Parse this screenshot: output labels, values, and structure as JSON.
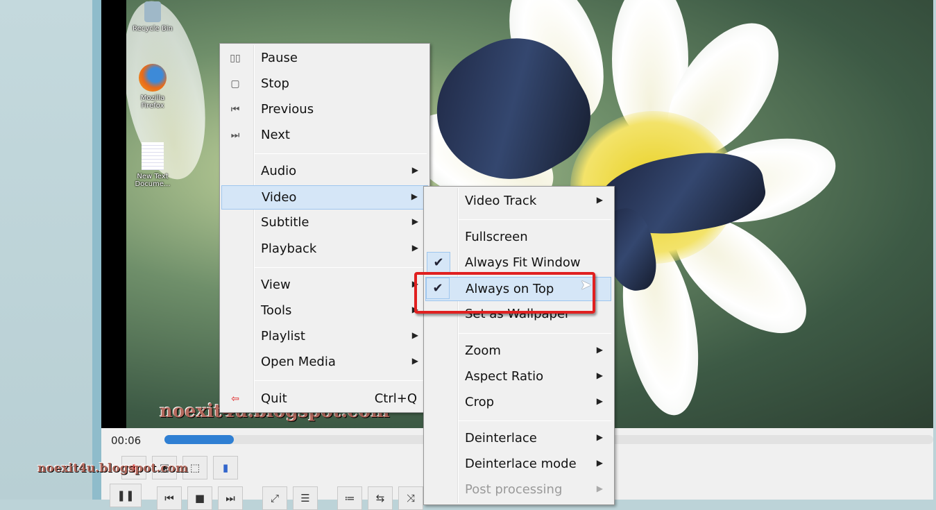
{
  "desktop_icons": [
    {
      "label": "Recycle Bin",
      "icon": "recycle-bin-icon"
    },
    {
      "label": "Mozilla Firefox",
      "icon": "firefox-icon"
    },
    {
      "label": "New Text Docume...",
      "icon": "text-document-icon"
    }
  ],
  "watermark": "noexit4u.blogspot.com",
  "player": {
    "time": "00:06",
    "progress_percent": 9,
    "accent": "#2f7fd3"
  },
  "context_menu": {
    "items": [
      {
        "label": "Pause",
        "icon": "pause-icon"
      },
      {
        "label": "Stop",
        "icon": "stop-icon"
      },
      {
        "label": "Previous",
        "icon": "previous-icon"
      },
      {
        "label": "Next",
        "icon": "next-icon"
      },
      {
        "label": "Audio"
      },
      {
        "label": "Video"
      },
      {
        "label": "Subtitle"
      },
      {
        "label": "Playback"
      },
      {
        "label": "View"
      },
      {
        "label": "Tools"
      },
      {
        "label": "Playlist"
      },
      {
        "label": "Open Media"
      },
      {
        "label": "Quit",
        "shortcut": "Ctrl+Q",
        "icon": "quit-icon"
      }
    ]
  },
  "video_submenu": {
    "items": [
      {
        "label": "Video Track"
      },
      {
        "label": "Fullscreen"
      },
      {
        "label": "Always Fit Window",
        "checked": true
      },
      {
        "label": "Always on Top",
        "checked": true
      },
      {
        "label": "Set as Wallpaper"
      },
      {
        "label": "Zoom"
      },
      {
        "label": "Aspect Ratio"
      },
      {
        "label": "Crop"
      },
      {
        "label": "Deinterlace"
      },
      {
        "label": "Deinterlace mode"
      },
      {
        "label": "Post processing",
        "disabled": true
      }
    ]
  },
  "annotation_color": "#e02020"
}
